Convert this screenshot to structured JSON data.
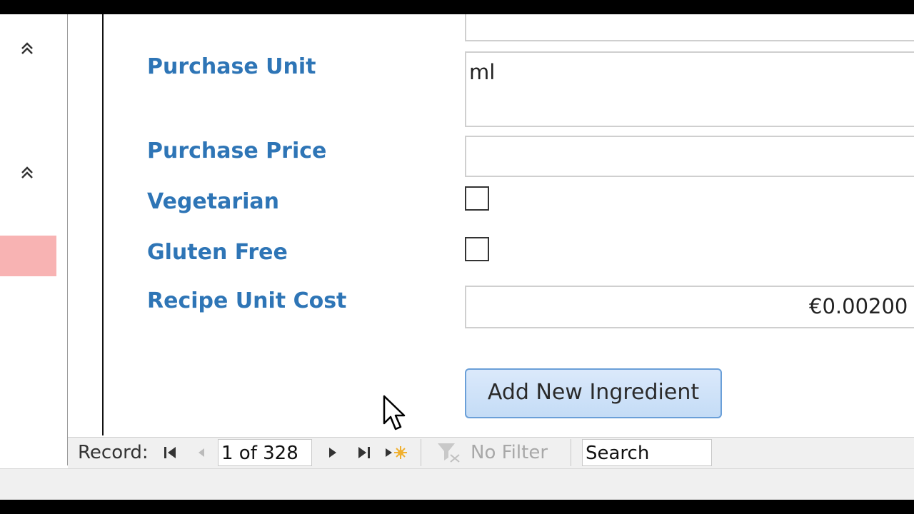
{
  "form": {
    "purchase_unit_label": "Purchase Unit",
    "purchase_unit_value": "ml",
    "purchase_price_label": "Purchase Price",
    "purchase_price_value": "",
    "vegetarian_label": "Vegetarian",
    "vegetarian_checked": false,
    "gluten_free_label": "Gluten Free",
    "gluten_free_checked": false,
    "recipe_unit_cost_label": "Recipe Unit Cost",
    "recipe_unit_cost_value": "€0.00200",
    "add_button_label": "Add New Ingredient"
  },
  "record_nav": {
    "label": "Record:",
    "position": "1 of 328",
    "filter_label": "No Filter",
    "search_placeholder": "Search"
  },
  "icons": {
    "nav_collapse": "double-chevron-up-icon",
    "first": "first-record-icon",
    "prev": "previous-record-icon",
    "next": "next-record-icon",
    "last": "last-record-icon",
    "new": "new-record-icon",
    "filter": "filter-icon"
  },
  "colors": {
    "label_blue": "#2e75b6",
    "nav_highlight": "#f8b3b3",
    "button_border": "#6a9fd8"
  }
}
